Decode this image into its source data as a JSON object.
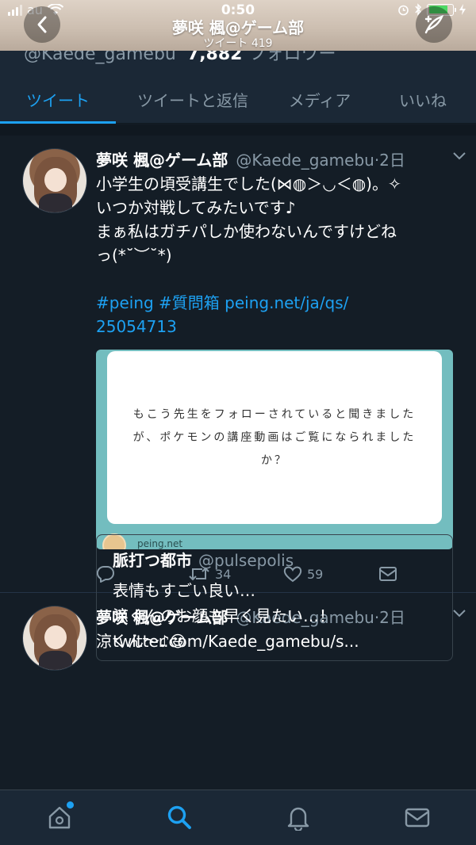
{
  "status_bar": {
    "carrier": "au",
    "time": "0:50"
  },
  "header": {
    "name": "夢咲 楓@ゲーム部",
    "tweet_count": "ツイート 419"
  },
  "profile_peek": {
    "handle": "@Kaede_gamebu",
    "followers_count": "7,882",
    "followers_label": "フォロワー"
  },
  "tabs": [
    {
      "label": "ツイート",
      "active": true
    },
    {
      "label": "ツイートと返信",
      "active": false
    },
    {
      "label": "メディア",
      "active": false
    },
    {
      "label": "いいね",
      "active": false
    }
  ],
  "tweets": [
    {
      "name": "夢咲 楓@ゲーム部",
      "handle": "@Kaede_gamebu",
      "time": "2日",
      "lines": [
        "小学生の頃受講生でした(⋈◍＞◡＜◍)。✧",
        "いつか対戦してみたいです♪",
        "まぁ私はガチパしか使わないんですけどね",
        "っ(*˘︶˘*)"
      ],
      "link_line1": "#peing #質問箱 peing.net/ja/qs/",
      "link_line2": "25054713",
      "card": {
        "text": "もこう先生をフォローされていると聞きましたが、ポケモンの講座動画はご覧になられましたか？",
        "site": "peing.net"
      },
      "retweets": "34",
      "likes": "59"
    },
    {
      "name": "夢咲 楓@ゲーム部",
      "handle": "@Kaede_gamebu",
      "time": "2日",
      "text": "涼くん〜♪😆",
      "quote": {
        "name": "脈打つ都市",
        "handle": "@pulsepolis",
        "lines": [
          "表情もすごい良い…",
          "涼くんのお顔も早く見たい…！",
          "twitter.com/Kaede_gamebu/s..."
        ]
      }
    }
  ],
  "colors": {
    "background": "#141d26",
    "panel": "#1b2836",
    "accent": "#1da1f2",
    "muted": "#8899a6",
    "card_bg": "#73bdbf"
  },
  "nav_icons": [
    "home-icon",
    "search-icon",
    "notifications-icon",
    "messages-icon"
  ]
}
